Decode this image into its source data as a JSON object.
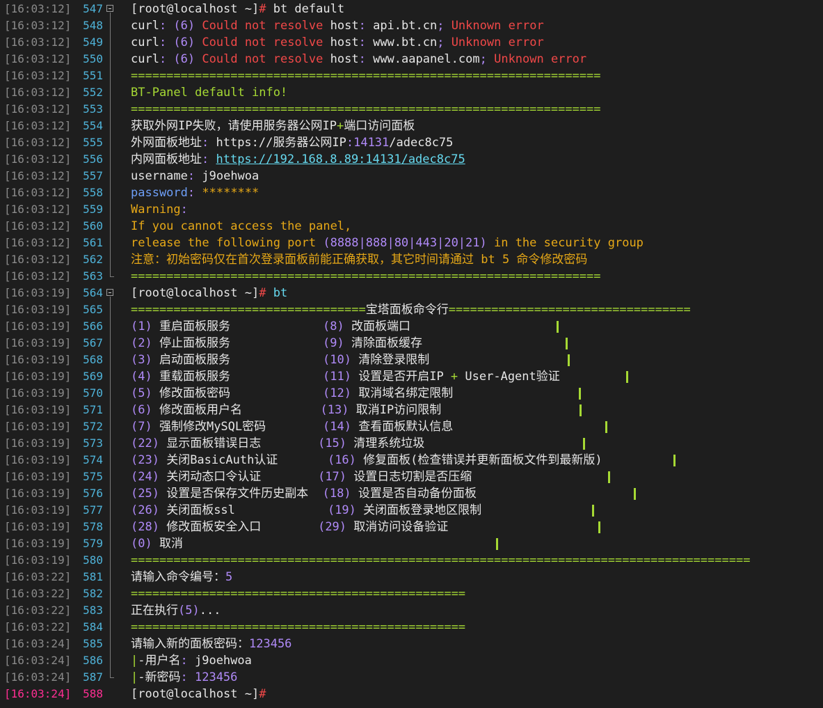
{
  "lines": [
    {
      "ts": "[16:03:12]",
      "ln": "547",
      "fold": "start",
      "segs": [
        {
          "t": "[root@localhost ~]",
          "c": "white"
        },
        {
          "t": "# ",
          "c": "red"
        },
        {
          "t": "bt default",
          "c": "white"
        }
      ]
    },
    {
      "ts": "[16:03:12]",
      "ln": "548",
      "fold": "mid",
      "segs": [
        {
          "t": "curl",
          "c": "white"
        },
        {
          "t": ": (",
          "c": "purple"
        },
        {
          "t": "6",
          "c": "purple"
        },
        {
          "t": ") ",
          "c": "purple"
        },
        {
          "t": "Could not resolve",
          "c": "red"
        },
        {
          "t": " host",
          "c": "white"
        },
        {
          "t": ": ",
          "c": "purple"
        },
        {
          "t": "api.bt.cn",
          "c": "white"
        },
        {
          "t": "; ",
          "c": "purple"
        },
        {
          "t": "Unknown error",
          "c": "red"
        }
      ]
    },
    {
      "ts": "[16:03:12]",
      "ln": "549",
      "fold": "mid",
      "segs": [
        {
          "t": "curl",
          "c": "white"
        },
        {
          "t": ": (",
          "c": "purple"
        },
        {
          "t": "6",
          "c": "purple"
        },
        {
          "t": ") ",
          "c": "purple"
        },
        {
          "t": "Could not resolve",
          "c": "red"
        },
        {
          "t": " host",
          "c": "white"
        },
        {
          "t": ": ",
          "c": "purple"
        },
        {
          "t": "www.bt.cn",
          "c": "white"
        },
        {
          "t": "; ",
          "c": "purple"
        },
        {
          "t": "Unknown error",
          "c": "red"
        }
      ]
    },
    {
      "ts": "[16:03:12]",
      "ln": "550",
      "fold": "mid",
      "segs": [
        {
          "t": "curl",
          "c": "white"
        },
        {
          "t": ": (",
          "c": "purple"
        },
        {
          "t": "6",
          "c": "purple"
        },
        {
          "t": ") ",
          "c": "purple"
        },
        {
          "t": "Could not resolve",
          "c": "red"
        },
        {
          "t": " host",
          "c": "white"
        },
        {
          "t": ": ",
          "c": "purple"
        },
        {
          "t": "www.aapanel.com",
          "c": "white"
        },
        {
          "t": "; ",
          "c": "purple"
        },
        {
          "t": "Unknown error",
          "c": "red"
        }
      ]
    },
    {
      "ts": "[16:03:12]",
      "ln": "551",
      "fold": "mid",
      "segs": [
        {
          "t": "==================================================================",
          "c": "green"
        }
      ]
    },
    {
      "ts": "[16:03:12]",
      "ln": "552",
      "fold": "mid",
      "segs": [
        {
          "t": "BT-Panel default info!",
          "c": "green"
        }
      ]
    },
    {
      "ts": "[16:03:12]",
      "ln": "553",
      "fold": "mid",
      "segs": [
        {
          "t": "==================================================================",
          "c": "green"
        }
      ]
    },
    {
      "ts": "[16:03:12]",
      "ln": "554",
      "fold": "mid",
      "segs": [
        {
          "t": "获取外网IP失败，请使用服务器公网IP",
          "c": "white"
        },
        {
          "t": "+",
          "c": "green"
        },
        {
          "t": "端口访问面板",
          "c": "white"
        }
      ]
    },
    {
      "ts": "[16:03:12]",
      "ln": "555",
      "fold": "mid",
      "segs": [
        {
          "t": "外网面板地址",
          "c": "white"
        },
        {
          "t": ": ",
          "c": "purple"
        },
        {
          "t": "https://服务器公网IP",
          "c": "white"
        },
        {
          "t": ":",
          "c": "purple"
        },
        {
          "t": "14131",
          "c": "purple"
        },
        {
          "t": "/adec8c75",
          "c": "white"
        }
      ]
    },
    {
      "ts": "[16:03:12]",
      "ln": "556",
      "fold": "mid",
      "segs": [
        {
          "t": "内网面板地址",
          "c": "white"
        },
        {
          "t": ": ",
          "c": "purple"
        },
        {
          "t": "https://192.168.8.89:14131/adec8c75",
          "c": "link"
        }
      ]
    },
    {
      "ts": "[16:03:12]",
      "ln": "557",
      "fold": "mid",
      "segs": [
        {
          "t": "username",
          "c": "white"
        },
        {
          "t": ": ",
          "c": "purple"
        },
        {
          "t": "j9oehwoa",
          "c": "white"
        }
      ]
    },
    {
      "ts": "[16:03:12]",
      "ln": "558",
      "fold": "mid",
      "segs": [
        {
          "t": "password",
          "c": "blue"
        },
        {
          "t": ": ",
          "c": "purple"
        },
        {
          "t": "********",
          "c": "yellow"
        }
      ]
    },
    {
      "ts": "[16:03:12]",
      "ln": "559",
      "fold": "mid",
      "segs": [
        {
          "t": "Warning",
          "c": "yellow"
        },
        {
          "t": ":",
          "c": "purple"
        }
      ]
    },
    {
      "ts": "[16:03:12]",
      "ln": "560",
      "fold": "mid",
      "segs": [
        {
          "t": "If you cannot access the panel,",
          "c": "yellow"
        }
      ]
    },
    {
      "ts": "[16:03:12]",
      "ln": "561",
      "fold": "mid",
      "segs": [
        {
          "t": "release the following port ",
          "c": "yellow"
        },
        {
          "t": "(8888|888|80|443|20|21)",
          "c": "purple"
        },
        {
          "t": " in the security group",
          "c": "yellow"
        }
      ]
    },
    {
      "ts": "[16:03:12]",
      "ln": "562",
      "fold": "mid",
      "segs": [
        {
          "t": "注意：初始密码仅在首次登录面板前能正确获取，其它时间请通过 bt 5 命令修改密码",
          "c": "yellow"
        }
      ]
    },
    {
      "ts": "[16:03:12]",
      "ln": "563",
      "fold": "end",
      "segs": [
        {
          "t": "==================================================================",
          "c": "green"
        }
      ]
    },
    {
      "ts": "[16:03:19]",
      "ln": "564",
      "fold": "start",
      "segs": [
        {
          "t": "[root@localhost ~]",
          "c": "white"
        },
        {
          "t": "# ",
          "c": "red"
        },
        {
          "t": "bt",
          "c": "cyan"
        }
      ]
    },
    {
      "ts": "[16:03:19]",
      "ln": "565",
      "fold": "mid",
      "segs": [
        {
          "t": "=================================",
          "c": "green"
        },
        {
          "t": "宝塔面板命令行",
          "c": "white"
        },
        {
          "t": "==================================",
          "c": "green"
        }
      ]
    },
    {
      "ts": "[16:03:19]",
      "ln": "566",
      "fold": "mid",
      "barLeft": 800,
      "segs": [
        {
          "t": "(1)",
          "c": "purple"
        },
        {
          "t": " 重启面板服务             ",
          "c": "white"
        },
        {
          "t": "(8)",
          "c": "purple"
        },
        {
          "t": " 改面板端口",
          "c": "white"
        }
      ]
    },
    {
      "ts": "[16:03:19]",
      "ln": "567",
      "fold": "mid",
      "barLeft": 813,
      "segs": [
        {
          "t": "(2)",
          "c": "purple"
        },
        {
          "t": " 停止面板服务             ",
          "c": "white"
        },
        {
          "t": "(9)",
          "c": "purple"
        },
        {
          "t": " 清除面板缓存",
          "c": "white"
        }
      ]
    },
    {
      "ts": "[16:03:19]",
      "ln": "568",
      "fold": "mid",
      "barLeft": 816,
      "segs": [
        {
          "t": "(3)",
          "c": "purple"
        },
        {
          "t": " 启动面板服务             ",
          "c": "white"
        },
        {
          "t": "(10)",
          "c": "purple"
        },
        {
          "t": " 清除登录限制",
          "c": "white"
        }
      ]
    },
    {
      "ts": "[16:03:19]",
      "ln": "569",
      "fold": "mid",
      "barLeft": 900,
      "segs": [
        {
          "t": "(4)",
          "c": "purple"
        },
        {
          "t": " 重载面板服务             ",
          "c": "white"
        },
        {
          "t": "(11)",
          "c": "purple"
        },
        {
          "t": " 设置是否开启IP ",
          "c": "white"
        },
        {
          "t": "+",
          "c": "green"
        },
        {
          "t": " User-Agent验证",
          "c": "white"
        }
      ]
    },
    {
      "ts": "[16:03:19]",
      "ln": "570",
      "fold": "mid",
      "barLeft": 832,
      "segs": [
        {
          "t": "(5)",
          "c": "purple"
        },
        {
          "t": " 修改面板密码             ",
          "c": "white"
        },
        {
          "t": "(12)",
          "c": "purple"
        },
        {
          "t": " 取消域名绑定限制",
          "c": "white"
        }
      ]
    },
    {
      "ts": "[16:03:19]",
      "ln": "571",
      "fold": "mid",
      "barLeft": 833,
      "segs": [
        {
          "t": "(6)",
          "c": "purple"
        },
        {
          "t": " 修改面板用户名           ",
          "c": "white"
        },
        {
          "t": "(13)",
          "c": "purple"
        },
        {
          "t": " 取消IP访问限制",
          "c": "white"
        }
      ]
    },
    {
      "ts": "[16:03:19]",
      "ln": "572",
      "fold": "mid",
      "barLeft": 870,
      "segs": [
        {
          "t": "(7)",
          "c": "purple"
        },
        {
          "t": " 强制修改MySQL密码        ",
          "c": "white"
        },
        {
          "t": "(14)",
          "c": "purple"
        },
        {
          "t": " 查看面板默认信息",
          "c": "white"
        }
      ]
    },
    {
      "ts": "[16:03:19]",
      "ln": "573",
      "fold": "mid",
      "barLeft": 838,
      "segs": [
        {
          "t": "(22)",
          "c": "purple"
        },
        {
          "t": " 显示面板错误日志        ",
          "c": "white"
        },
        {
          "t": "(15)",
          "c": "purple"
        },
        {
          "t": " 清理系统垃圾",
          "c": "white"
        }
      ]
    },
    {
      "ts": "[16:03:19]",
      "ln": "574",
      "fold": "mid",
      "barLeft": 968,
      "segs": [
        {
          "t": "(23)",
          "c": "purple"
        },
        {
          "t": " 关闭BasicAuth认证       ",
          "c": "white"
        },
        {
          "t": "(16)",
          "c": "purple"
        },
        {
          "t": " 修复面板(检查错误并更新面板文件到最新版)",
          "c": "white"
        }
      ]
    },
    {
      "ts": "[16:03:19]",
      "ln": "575",
      "fold": "mid",
      "barLeft": 874,
      "segs": [
        {
          "t": "(24)",
          "c": "purple"
        },
        {
          "t": " 关闭动态口令认证        ",
          "c": "white"
        },
        {
          "t": "(17)",
          "c": "purple"
        },
        {
          "t": " 设置日志切割是否压缩",
          "c": "white"
        }
      ]
    },
    {
      "ts": "[16:03:19]",
      "ln": "576",
      "fold": "mid",
      "barLeft": 911,
      "segs": [
        {
          "t": "(25)",
          "c": "purple"
        },
        {
          "t": " 设置是否保存文件历史副本  ",
          "c": "white"
        },
        {
          "t": "(18)",
          "c": "purple"
        },
        {
          "t": " 设置是否自动备份面板",
          "c": "white"
        }
      ]
    },
    {
      "ts": "[16:03:19]",
      "ln": "577",
      "fold": "mid",
      "barLeft": 851,
      "segs": [
        {
          "t": "(26)",
          "c": "purple"
        },
        {
          "t": " 关闭面板ssl             ",
          "c": "white"
        },
        {
          "t": "(19)",
          "c": "purple"
        },
        {
          "t": " 关闭面板登录地区限制",
          "c": "white"
        }
      ]
    },
    {
      "ts": "[16:03:19]",
      "ln": "578",
      "fold": "mid",
      "barLeft": 860,
      "segs": [
        {
          "t": "(28)",
          "c": "purple"
        },
        {
          "t": " 修改面板安全入口        ",
          "c": "white"
        },
        {
          "t": "(29)",
          "c": "purple"
        },
        {
          "t": " 取消访问设备验证",
          "c": "white"
        }
      ]
    },
    {
      "ts": "[16:03:19]",
      "ln": "579",
      "fold": "mid",
      "barLeft": 713,
      "segs": [
        {
          "t": "(0)",
          "c": "purple"
        },
        {
          "t": " 取消",
          "c": "white"
        }
      ]
    },
    {
      "ts": "[16:03:19]",
      "ln": "580",
      "fold": "mid",
      "segs": [
        {
          "t": "=======================================================================================",
          "c": "green"
        }
      ]
    },
    {
      "ts": "[16:03:22]",
      "ln": "581",
      "fold": "mid",
      "segs": [
        {
          "t": "请输入命令编号：",
          "c": "white"
        },
        {
          "t": "5",
          "c": "purple"
        }
      ]
    },
    {
      "ts": "[16:03:22]",
      "ln": "582",
      "fold": "mid",
      "segs": [
        {
          "t": "===============================================",
          "c": "green"
        }
      ]
    },
    {
      "ts": "[16:03:22]",
      "ln": "583",
      "fold": "mid",
      "segs": [
        {
          "t": "正在执行",
          "c": "white"
        },
        {
          "t": "(5)",
          "c": "purple"
        },
        {
          "t": "...",
          "c": "white"
        }
      ]
    },
    {
      "ts": "[16:03:22]",
      "ln": "584",
      "fold": "mid",
      "segs": [
        {
          "t": "===============================================",
          "c": "green"
        }
      ]
    },
    {
      "ts": "[16:03:24]",
      "ln": "585",
      "fold": "mid",
      "segs": [
        {
          "t": "请输入新的面板密码：",
          "c": "white"
        },
        {
          "t": "123456",
          "c": "purple"
        }
      ]
    },
    {
      "ts": "[16:03:24]",
      "ln": "586",
      "fold": "mid",
      "segs": [
        {
          "t": "|",
          "c": "green"
        },
        {
          "t": "-用户名",
          "c": "white"
        },
        {
          "t": ": ",
          "c": "purple"
        },
        {
          "t": "j9oehwoa",
          "c": "white"
        }
      ]
    },
    {
      "ts": "[16:03:24]",
      "ln": "587",
      "fold": "end",
      "segs": [
        {
          "t": "|",
          "c": "green"
        },
        {
          "t": "-新密码",
          "c": "white"
        },
        {
          "t": ": ",
          "c": "purple"
        },
        {
          "t": "123456",
          "c": "purple"
        }
      ]
    },
    {
      "ts": "[16:03:24]",
      "ln": "588",
      "fold": "none",
      "current": true,
      "segs": [
        {
          "t": "[root@localhost ~]",
          "c": "white"
        },
        {
          "t": "#",
          "c": "red"
        }
      ]
    }
  ]
}
